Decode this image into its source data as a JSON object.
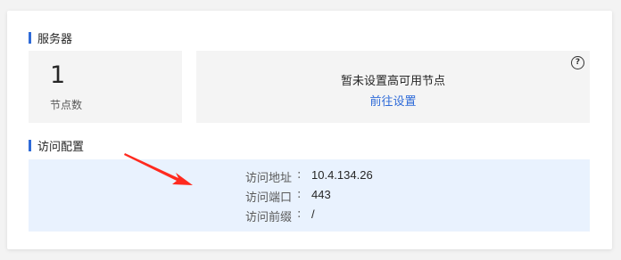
{
  "server_section": {
    "title": "服务器",
    "node_count": "1",
    "node_count_label": "节点数",
    "ha_message": "暂未设置高可用节点",
    "ha_link": "前往设置",
    "help_icon": "question-circle-icon"
  },
  "access_section": {
    "title": "访问配置",
    "rows": [
      {
        "key": "访问地址",
        "value": "10.4.134.26"
      },
      {
        "key": "访问端口",
        "value": "443"
      },
      {
        "key": "访问前缀",
        "value": "/"
      }
    ]
  },
  "annotation": {
    "icon": "red-arrow-icon",
    "color": "#ff2a1f"
  },
  "colors": {
    "accent": "#2f6bd8",
    "access_bg": "#e9f2fe"
  }
}
